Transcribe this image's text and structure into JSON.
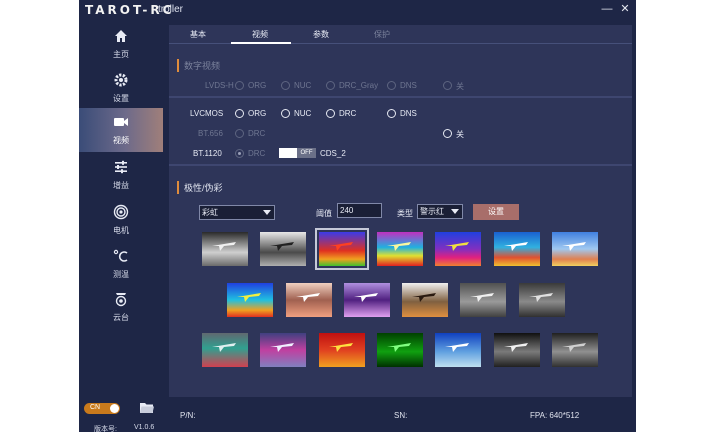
{
  "app": {
    "logo": "TAROT-RC",
    "title": "troller",
    "window_controls": [
      "—",
      "✕"
    ]
  },
  "sidebar": {
    "items": [
      {
        "label": "主页",
        "icon": "home-icon"
      },
      {
        "label": "设置",
        "icon": "gear-icon"
      },
      {
        "label": "视频",
        "icon": "video-camera-icon",
        "active": true
      },
      {
        "label": "增益",
        "icon": "sliders-icon"
      },
      {
        "label": "电机",
        "icon": "motor-icon"
      },
      {
        "label": "测温",
        "icon": "celsius-icon"
      },
      {
        "label": "云台",
        "icon": "gimbal-icon"
      }
    ],
    "lang": "CN",
    "version_label": "版本号:",
    "version": "V1.0.6"
  },
  "tabs": [
    {
      "label": "基本"
    },
    {
      "label": "视频",
      "active": true
    },
    {
      "label": "参数"
    },
    {
      "label": "保护",
      "disabled": true
    }
  ],
  "digital_video": {
    "title": "数字视频",
    "lvds": {
      "label": "LVDS-H",
      "options": [
        "ORG",
        "NUC",
        "DRC_Gray",
        "DNS",
        "关"
      ]
    }
  },
  "analog": {
    "lvcmos": {
      "label": "LVCMOS",
      "options": [
        "ORG",
        "NUC",
        "DRC",
        "DNS"
      ]
    },
    "off_label": "关",
    "bt656": {
      "label": "BT.656",
      "option": "DRC"
    },
    "bt1120": {
      "label": "BT.1120",
      "option": "DRC",
      "toggle": "OFF",
      "cds": "CDS_2"
    }
  },
  "palette": {
    "title": "极性/伪彩",
    "palette_select": "彩虹",
    "threshold_label": "阈值",
    "threshold_value": "240",
    "type_label": "类型",
    "type_select": "警示红",
    "apply_button": "设置"
  },
  "status": {
    "pn": "P/N:",
    "sn": "SN:",
    "fpa": "FPA:  640*512"
  },
  "colors": {
    "accent": "#e08c3c",
    "sidebar_active": "#6d6a8a",
    "button": "#a86e6a",
    "lang_toggle": "#c97a1c"
  }
}
